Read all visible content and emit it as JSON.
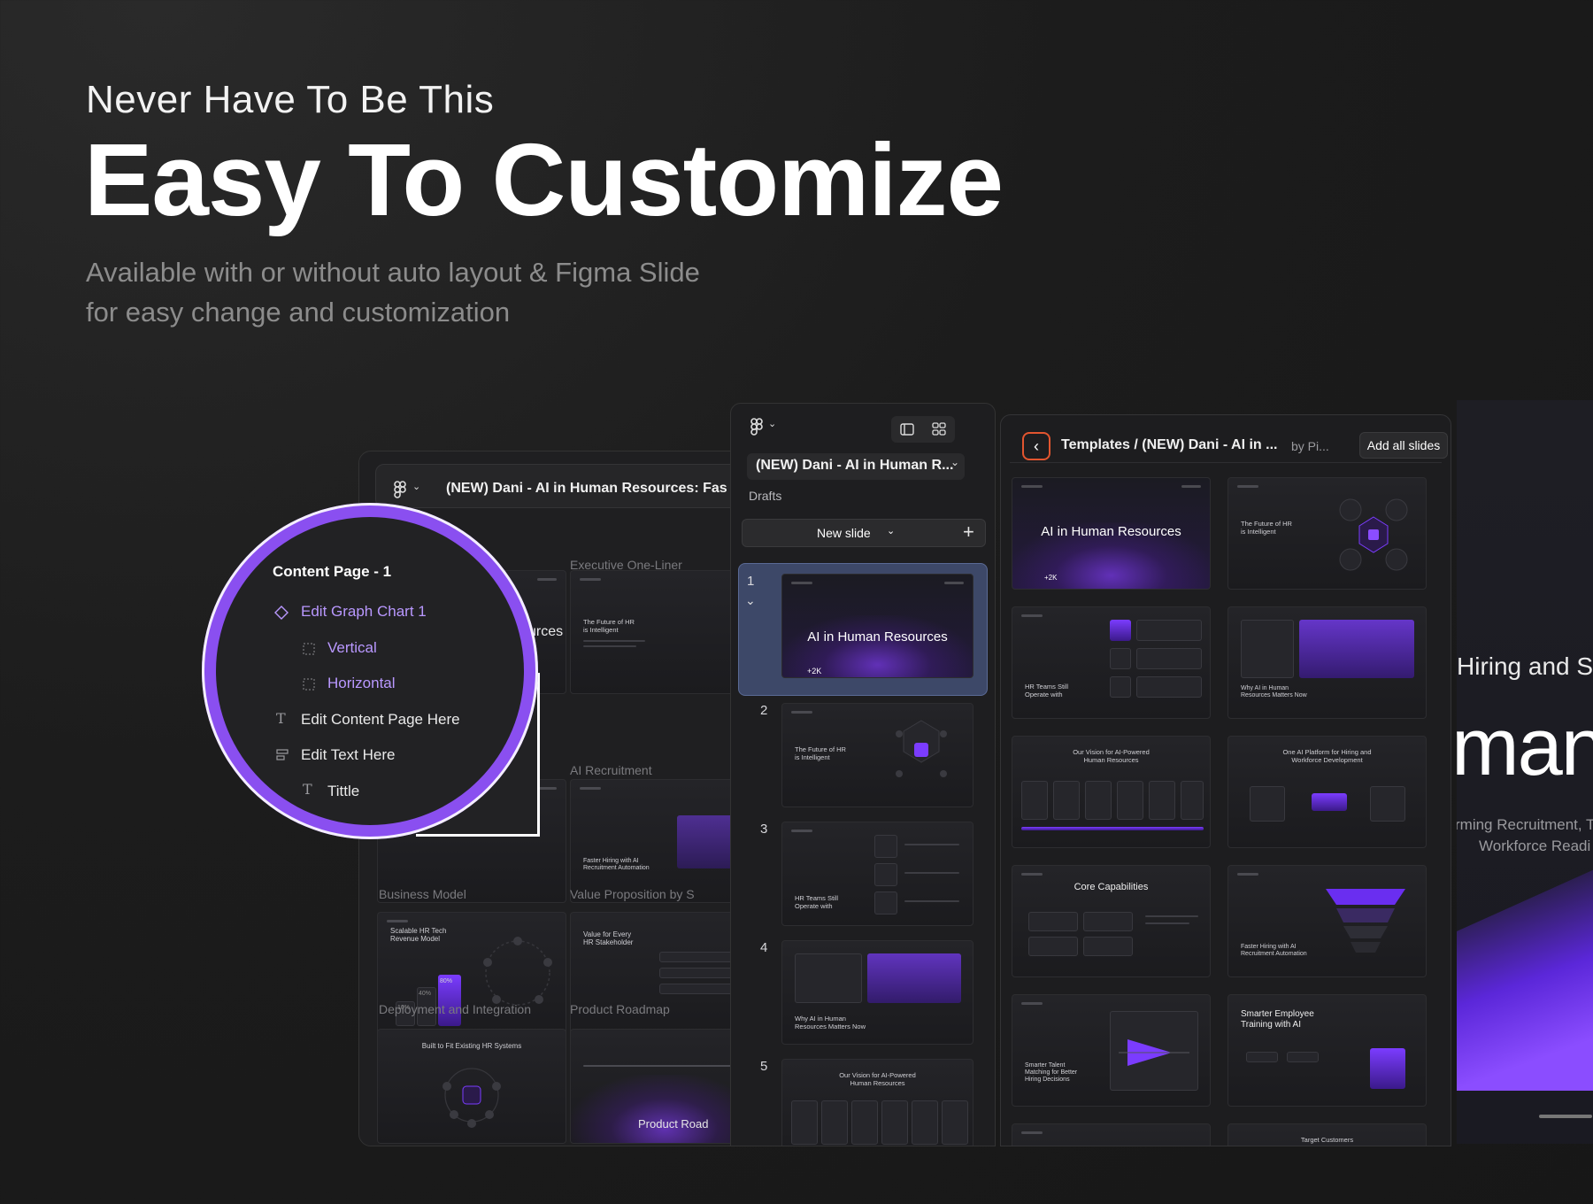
{
  "hero": {
    "kicker": "Never Have To Be This",
    "title": "Easy To Customize",
    "subtitle_line1": "Available with or without auto layout  & Figma Slide",
    "subtitle_line2": "for easy change and customization"
  },
  "left_window": {
    "file_title": "(NEW) Dani - AI in Human Resources: Fas",
    "sections": [
      "Executive One-Liner",
      "AI Recruitment",
      "Business Model",
      "Value Proposition by S",
      "Deployment and Integration",
      "Product Roadmap"
    ],
    "thumbs": {
      "a_rces": "urces",
      "future": "The Future of HR\nis Intelligent",
      "faster": "Faster Hiring with AI\nRecruitment Automation",
      "scalable": "Scalable HR Tech\nRevenue Model",
      "value_every": "Value for Every\nHR Stakeholder",
      "built_fit": "Built to Fit Existing HR Systems",
      "roadmap": "Product Road",
      "pct_80": "80%",
      "pct_40": "40%",
      "pct_10": "10%"
    }
  },
  "zoom_layers": {
    "head": "Content Page - 1",
    "items": [
      {
        "label": "Edit Graph Chart 1",
        "icon": "component-icon"
      },
      {
        "label": "Vertical",
        "icon": "frame-dashed-icon"
      },
      {
        "label": "Horizontal",
        "icon": "frame-dashed-icon"
      },
      {
        "label": "Edit Content Page Here",
        "icon": "text-icon"
      },
      {
        "label": "Edit Text Here",
        "icon": "autolayout-icon"
      },
      {
        "label": "Tittle",
        "icon": "text-icon"
      }
    ]
  },
  "middle_panel": {
    "file_name": "(NEW) Dani - AI in Human R...",
    "drafts": "Drafts",
    "new_slide": "New slide",
    "slides": [
      {
        "num": "1",
        "title": "AI in Human Resources",
        "stat": "+2K"
      },
      {
        "num": "2",
        "title": "The Future of HR\nis Intelligent"
      },
      {
        "num": "3",
        "title": "HR Teams Still\nOperate with"
      },
      {
        "num": "4",
        "title": "Why AI in Human\nResources Matters Now"
      },
      {
        "num": "5",
        "title": "Our Vision for AI-Powered\nHuman Resources"
      }
    ]
  },
  "templates_panel": {
    "path": "Templates / (NEW) Dani - AI in ...",
    "by": "by Pi...",
    "add_all": "Add all slides",
    "thumbs": [
      "AI in Human Resources",
      "The Future of HR\nis Intelligent",
      "HR Teams Still\nOperate with",
      "Why AI in Human\nResources Matters Now",
      "Our Vision for AI-Powered\nHuman Resources",
      "One AI Platform for Hiring and\nWorkforce Development",
      "Core Capabilities",
      "Faster Hiring with AI\nRecruitment Automation",
      "Smarter Talent\nMatching for Better\nHiring Decisions",
      "Smarter Employee\nTraining with AI",
      "",
      "Target Customers"
    ],
    "stat": "+2K"
  },
  "big_slide": {
    "hiring": "Hiring and S",
    "man": "man",
    "sub1": "rming Recruitment, T",
    "sub2": "Workforce Readi"
  },
  "colors": {
    "accent_purple": "#8a4ff0",
    "back_btn_orange": "#e2552f",
    "selected_slide": "#3d4868"
  }
}
